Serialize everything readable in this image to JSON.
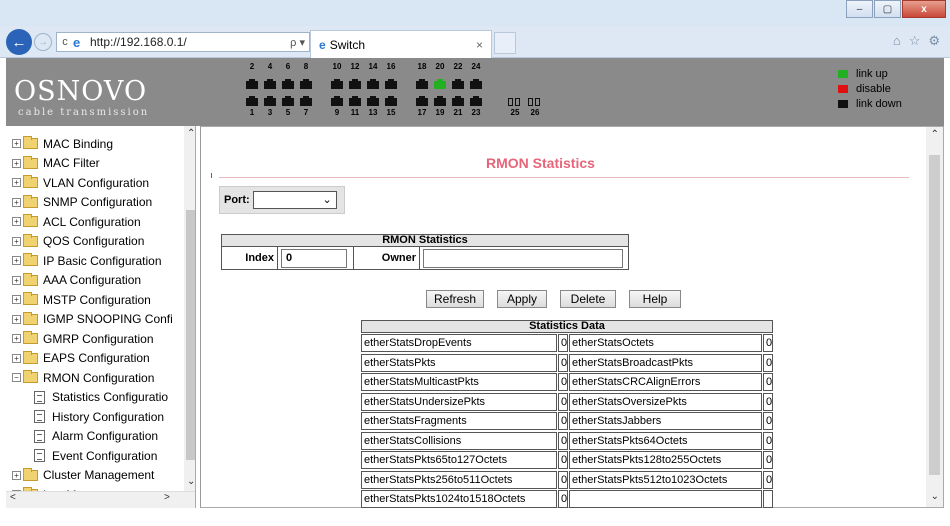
{
  "browser": {
    "url": "http://192.168.0.1/",
    "tab_title": "Switch",
    "tab_close": "×",
    "search_glyph": "ρ ▾",
    "refresh_glyph": "c",
    "minimize": "–",
    "maximize": "▢",
    "close": "x",
    "toolbar_icons": [
      "⌂",
      "☆",
      "⚙"
    ]
  },
  "device": {
    "logo": "OSNOVO",
    "logo_sub": "cable transmission",
    "top_port_numbers": [
      "2",
      "4",
      "6",
      "8",
      "10",
      "12",
      "14",
      "16",
      "18",
      "20",
      "22",
      "24"
    ],
    "bottom_port_numbers": [
      "1",
      "3",
      "5",
      "7",
      "9",
      "11",
      "13",
      "15",
      "17",
      "19",
      "21",
      "23"
    ],
    "sfp_port_numbers": [
      "25",
      "26"
    ],
    "active_port": "20",
    "legend": [
      {
        "label": "link up",
        "color": "#22b022"
      },
      {
        "label": "disable",
        "color": "#e01010"
      },
      {
        "label": "link down",
        "color": "#111111"
      }
    ]
  },
  "sidebar": {
    "items": [
      {
        "label": "MAC Binding",
        "type": "folder"
      },
      {
        "label": "MAC Filter",
        "type": "folder"
      },
      {
        "label": "VLAN Configuration",
        "type": "folder"
      },
      {
        "label": "SNMP Configuration",
        "type": "folder"
      },
      {
        "label": "ACL Configuration",
        "type": "folder"
      },
      {
        "label": "QOS Configuration",
        "type": "folder"
      },
      {
        "label": "IP Basic Configuration",
        "type": "folder"
      },
      {
        "label": "AAA Configuration",
        "type": "folder"
      },
      {
        "label": "MSTP Configuration",
        "type": "folder"
      },
      {
        "label": "IGMP SNOOPING Confi",
        "type": "folder"
      },
      {
        "label": "GMRP Configuration",
        "type": "folder"
      },
      {
        "label": "EAPS Configuration",
        "type": "folder"
      },
      {
        "label": "RMON Configuration",
        "type": "open-folder"
      },
      {
        "label": "Statistics Configuratio",
        "type": "doc"
      },
      {
        "label": "History Configuration",
        "type": "doc"
      },
      {
        "label": "Alarm Configuration",
        "type": "doc"
      },
      {
        "label": "Event Configuration",
        "type": "doc"
      },
      {
        "label": "Cluster Management",
        "type": "folder"
      },
      {
        "label": "Log Management",
        "type": "folder"
      }
    ]
  },
  "main": {
    "title": "RMON Statistics",
    "port_label": "Port:",
    "port_value": "",
    "rmon_table": {
      "header": "RMON Statistics",
      "index_label": "Index",
      "index_value": "0",
      "owner_label": "Owner",
      "owner_value": ""
    },
    "buttons": {
      "refresh": "Refresh",
      "apply": "Apply",
      "delete": "Delete",
      "help": "Help"
    },
    "stats_table": {
      "header": "Statistics Data",
      "rows": [
        {
          "n1": "etherStatsDropEvents",
          "v1": "0",
          "n2": "etherStatsOctets",
          "v2": "0"
        },
        {
          "n1": "etherStatsPkts",
          "v1": "0",
          "n2": "etherStatsBroadcastPkts",
          "v2": "0"
        },
        {
          "n1": "etherStatsMulticastPkts",
          "v1": "0",
          "n2": "etherStatsCRCAlignErrors",
          "v2": "0"
        },
        {
          "n1": "etherStatsUndersizePkts",
          "v1": "0",
          "n2": "etherStatsOversizePkts",
          "v2": "0"
        },
        {
          "n1": "etherStatsFragments",
          "v1": "0",
          "n2": "etherStatsJabbers",
          "v2": "0"
        },
        {
          "n1": "etherStatsCollisions",
          "v1": "0",
          "n2": "etherStatsPkts64Octets",
          "v2": "0"
        },
        {
          "n1": "etherStatsPkts65to127Octets",
          "v1": "0",
          "n2": "etherStatsPkts128to255Octets",
          "v2": "0"
        },
        {
          "n1": "etherStatsPkts256to511Octets",
          "v1": "0",
          "n2": "etherStatsPkts512to1023Octets",
          "v2": "0"
        },
        {
          "n1": "etherStatsPkts1024to1518Octets",
          "v1": "0",
          "n2": "",
          "v2": ""
        }
      ]
    }
  }
}
